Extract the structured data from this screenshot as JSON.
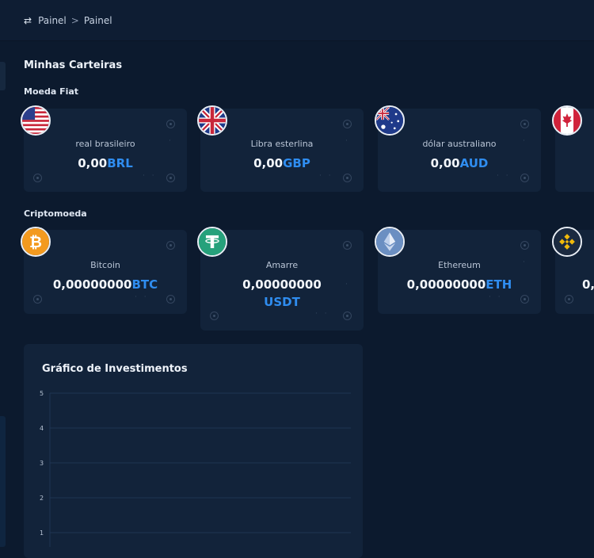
{
  "breadcrumb": {
    "items": [
      "Painel",
      "Painel"
    ],
    "separator": ">"
  },
  "wallets": {
    "title": "Minhas Carteiras",
    "fiat_title": "Moeda Fiat",
    "crypto_title": "Criptomoeda",
    "fiat": [
      {
        "name": "real brasileiro",
        "amount": "0,00",
        "currency": "BRL",
        "icon": "us-flag-icon"
      },
      {
        "name": "Libra esterlina",
        "amount": "0,00",
        "currency": "GBP",
        "icon": "uk-flag-icon"
      },
      {
        "name": "dólar australiano",
        "amount": "0,00",
        "currency": "AUD",
        "icon": "australia-flag-icon"
      },
      {
        "name": "",
        "amount": "",
        "currency": "",
        "icon": "canada-flag-icon"
      }
    ],
    "crypto": [
      {
        "name": "Bitcoin",
        "amount": "0,00000000",
        "currency": "BTC",
        "icon": "bitcoin-icon"
      },
      {
        "name": "Amarre",
        "amount": "0,00000000",
        "currency": "USDT",
        "icon": "tether-icon"
      },
      {
        "name": "Ethereum",
        "amount": "0,00000000",
        "currency": "ETH",
        "icon": "ethereum-icon"
      },
      {
        "name": "",
        "amount": "0,",
        "currency": "",
        "icon": "binance-icon"
      }
    ]
  },
  "colors": {
    "accent": "#2f8df0",
    "card": "#12233a",
    "background": "#0c1a2e"
  },
  "investments_chart": {
    "title": "Gráfico de Investimentos",
    "chart_data": {
      "type": "line",
      "title": "Gráfico de Investimentos",
      "y_ticks": [
        "5",
        "4",
        "3",
        "2",
        "1"
      ],
      "ylim": [
        0,
        5
      ],
      "grid": true,
      "series": []
    }
  }
}
